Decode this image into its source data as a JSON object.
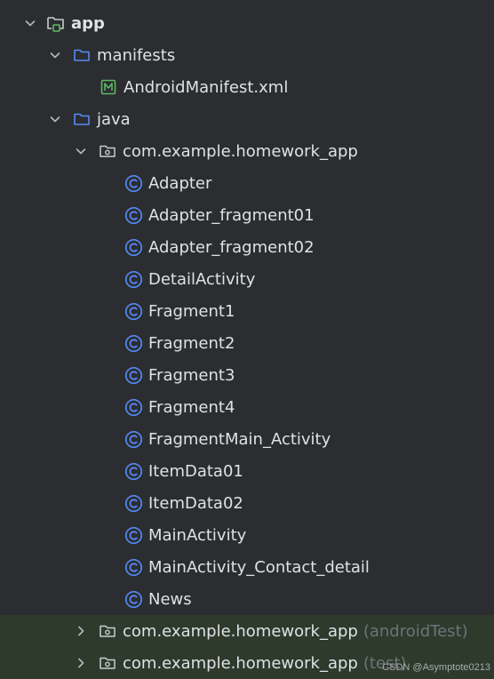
{
  "colors": {
    "background": "#2b2d30",
    "text": "#dfe1e5",
    "muted": "#6f737a",
    "folder": "#548af7",
    "class_icon": "#548af7",
    "manifest_icon": "#5fb865",
    "highlight": "#2d3a2c"
  },
  "tree": {
    "app": {
      "label": "app",
      "icon": "module-folder-icon",
      "expanded": true
    },
    "manifests": {
      "label": "manifests",
      "icon": "folder-icon",
      "expanded": true,
      "items": [
        {
          "label": "AndroidManifest.xml",
          "icon": "manifest-file-icon"
        }
      ]
    },
    "java": {
      "label": "java",
      "icon": "folder-icon",
      "expanded": true,
      "main_package": {
        "label": "com.example.homework_app",
        "icon": "package-icon",
        "expanded": true,
        "classes": [
          "Adapter",
          "Adapter_fragment01",
          "Adapter_fragment02",
          "DetailActivity",
          "Fragment1",
          "Fragment2",
          "Fragment3",
          "Fragment4",
          "FragmentMain_Activity",
          "ItemData01",
          "ItemData02",
          "MainActivity",
          "MainActivity_Contact_detail",
          "News"
        ]
      },
      "android_test_package": {
        "label": "com.example.homework_app",
        "suffix": "(androidTest)",
        "icon": "package-icon",
        "expanded": false
      },
      "test_package": {
        "label": "com.example.homework_app",
        "suffix": "(test)",
        "icon": "package-icon",
        "expanded": false
      }
    }
  },
  "watermark": "CSDN @Asymptote0213"
}
